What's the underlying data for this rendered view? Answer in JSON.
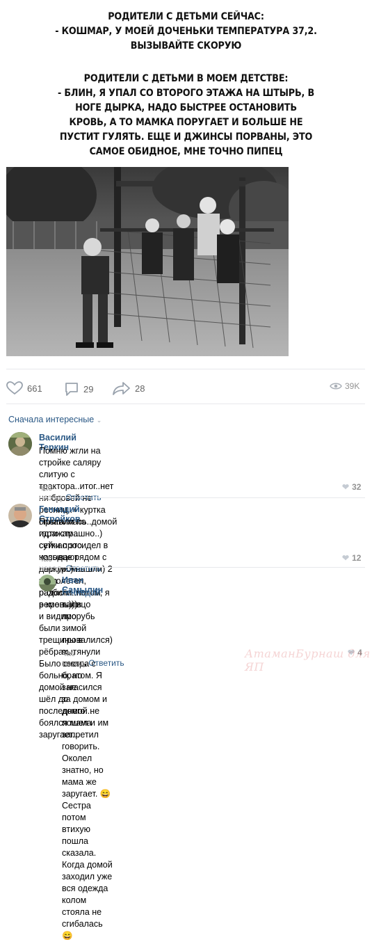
{
  "meme": {
    "block1": [
      "РОДИТЕЛИ С ДЕТЬМИ СЕЙЧАС:",
      "- КОШМАР, У МОЕЙ ДОЧЕНЬКИ ТЕМПЕРАТУРА 37,2.",
      "ВЫЗЫВАЙТЕ СКОРУЮ"
    ],
    "block2": [
      "РОДИТЕЛИ С ДЕТЬМИ В МОЕМ ДЕТСТВЕ:",
      "- БЛИН, Я УПАЛ СО ВТОРОГО ЭТАЖА НА ШТЫРЬ, В",
      "НОГЕ ДЫРКА, НАДО БЫСТРЕЕ ОСТАНОВИТЬ",
      "КРОВЬ, А ТО МАМКА ПОРУГАЕТ И БОЛЬШЕ НЕ",
      "ПУСТИТ ГУЛЯТЬ. ЕЩЕ И ДЖИНСЫ ПОРВАНЫ, ЭТО",
      "САМОЕ ОБИДНОЕ, МНЕ ТОЧНО ПИПЕЦ"
    ]
  },
  "post_actions": {
    "likes": "661",
    "comments": "29",
    "shares": "28",
    "views": "39K"
  },
  "sort_label": "Сначала интересные",
  "comments": [
    {
      "author": "Василий Теркин",
      "lines": [
        "Помню жгли на стройке саляру слитую с трактора..итог..нет ни бровей не",
        "ресниц..+ куртка оплавилась..домой идти страшно..) сутки просидел в",
        "колодце рядом с домом..) нашли) 2 часа радости..потом ремень)))"
      ],
      "time": "час назад",
      "reply": "Ответить",
      "likes": "32"
    },
    {
      "author": "Геннадий Стройков",
      "lines": [
        "Прыгали по гаражам... сейчас это называют паркуром... не долетел, разбил",
        "в кровь лицо и видимо были трещины в рёбрах... Было очень больно, но",
        "домой не шёл до последнего... боялся мама заругает..."
      ],
      "time": "час назад",
      "reply": "Ответить",
      "likes": "12"
    },
    {
      "author": "Иван Самылин",
      "mention": "Геннадий",
      "lines": [
        ", я так в прорубь зимой провалился) вытянули сестра с",
        "братом. Я загасился за домом и домой не пошел и им запретил",
        "говорить. Околел знатно, но мама же заругает. 😄 Сестра потом",
        "втихую пошла сказала. Когда домой заходил уже вся одежда колом",
        "стояла не сгибалась😄"
      ],
      "time": "час назад",
      "reply": "Ответить",
      "likes": "4"
    }
  ],
  "watermark": "АтаманБурнаш для ЯП",
  "colors": {
    "link": "#2a5885",
    "muted": "#828a99",
    "divider": "#e7e8ec"
  }
}
